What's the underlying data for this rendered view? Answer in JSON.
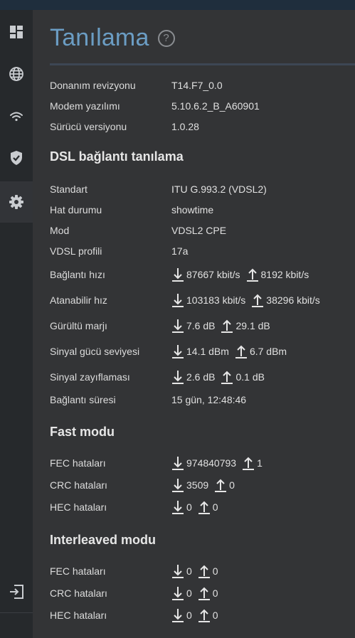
{
  "page": {
    "title": "Tanılama",
    "help_glyph": "?"
  },
  "sidebar": {
    "items": [
      {
        "name": "dashboard",
        "icon": "dashboard-icon"
      },
      {
        "name": "internet",
        "icon": "globe-icon"
      },
      {
        "name": "wifi",
        "icon": "wifi-icon"
      },
      {
        "name": "security",
        "icon": "shield-check-icon"
      },
      {
        "name": "settings",
        "icon": "gear-icon",
        "active": true
      },
      {
        "name": "logout",
        "icon": "logout-icon"
      },
      {
        "name": "menu",
        "icon": "menu-icon"
      }
    ]
  },
  "device": {
    "hw_label": "Donanım revizyonu",
    "hw_value": "T14.F7_0.0",
    "fw_label": "Modem yazılımı",
    "fw_value": "5.10.6.2_B_A60901",
    "drv_label": "Sürücü versiyonu",
    "drv_value": "1.0.28"
  },
  "dsl": {
    "heading": "DSL bağlantı tanılama",
    "standard_label": "Standart",
    "standard_value": "ITU G.993.2 (VDSL2)",
    "line_label": "Hat durumu",
    "line_value": "showtime",
    "mode_label": "Mod",
    "mode_value": "VDSL2 CPE",
    "profile_label": "VDSL profili",
    "profile_value": "17a",
    "rate_label": "Bağlantı hızı",
    "rate_down": "87667 kbit/s",
    "rate_up": "8192 kbit/s",
    "attain_label": "Atanabilir hız",
    "attain_down": "103183 kbit/s",
    "attain_up": "38296 kbit/s",
    "snr_label": "Gürültü marjı",
    "snr_down": "7.6 dB",
    "snr_up": "29.1 dB",
    "power_label": "Sinyal gücü seviyesi",
    "power_down": "14.1 dBm",
    "power_up": "6.7 dBm",
    "atten_label": "Sinyal zayıflaması",
    "atten_down": "2.6 dB",
    "atten_up": "0.1 dB",
    "uptime_label": "Bağlantı süresi",
    "uptime_value": "15 gün, 12:48:46"
  },
  "fast": {
    "heading": "Fast modu",
    "fec_label": "FEC hataları",
    "fec_down": "974840793",
    "fec_up": "1",
    "crc_label": "CRC hataları",
    "crc_down": "3509",
    "crc_up": "0",
    "hec_label": "HEC hataları",
    "hec_down": "0",
    "hec_up": "0"
  },
  "interleaved": {
    "heading": "Interleaved modu",
    "fec_label": "FEC hataları",
    "fec_down": "0",
    "fec_up": "0",
    "crc_label": "CRC hataları",
    "crc_down": "0",
    "crc_up": "0",
    "hec_label": "HEC hataları",
    "hec_down": "0",
    "hec_up": "0"
  }
}
